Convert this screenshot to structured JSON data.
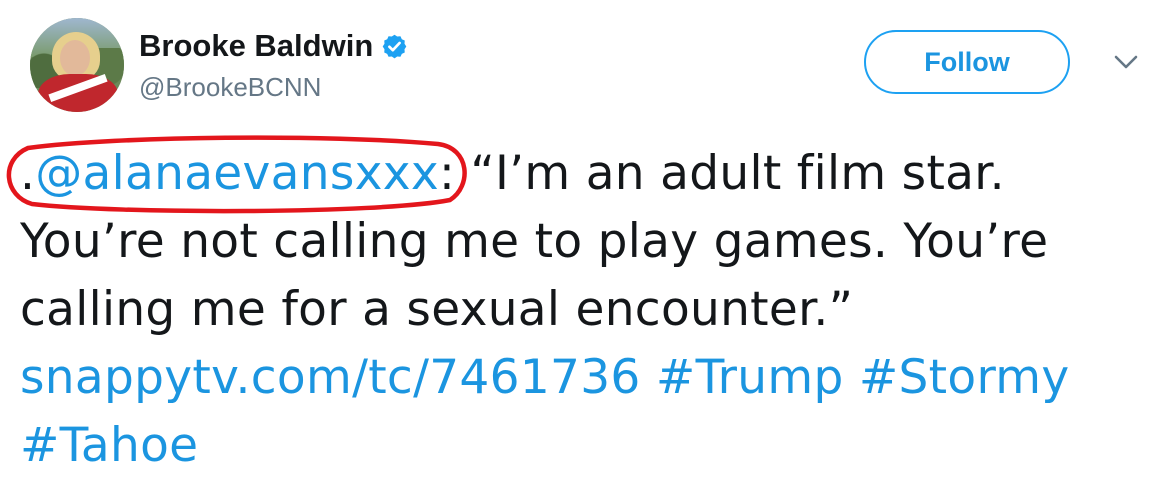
{
  "header": {
    "display_name": "Brooke Baldwin",
    "handle": "@BrookeBCNN",
    "follow_label": "Follow"
  },
  "tweet": {
    "lead_dot": ".",
    "mention": "@alanaevansxxx",
    "after_mention": ": “I’m an adult film star.",
    "line2": "You’re not calling me to play games. You’re",
    "line3": "calling me for a sexual encounter.”",
    "link": "snappytv.com/tc/7461736",
    "hashtags": [
      "#Trump",
      "#Stormy",
      "#Tahoe"
    ]
  },
  "colors": {
    "link": "#1b95e0",
    "verified": "#1da1f2",
    "annotation": "#e3161c",
    "text": "#14171a",
    "handle": "#657786"
  },
  "icons": {
    "verified": "verified-badge-icon",
    "menu": "chevron-down-icon"
  }
}
